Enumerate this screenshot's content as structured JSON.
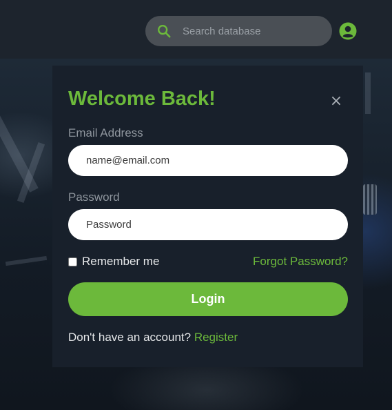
{
  "search": {
    "placeholder": "Search database",
    "icon": "search-icon"
  },
  "account": {
    "icon": "user-circle-icon"
  },
  "login_modal": {
    "title": "Welcome Back!",
    "close_symbol": "×",
    "email": {
      "label": "Email Address",
      "placeholder": "name@email.com"
    },
    "password": {
      "label": "Password",
      "placeholder": "Password"
    },
    "remember_label": "Remember me",
    "remember_checked": false,
    "forgot_label": "Forgot Password?",
    "login_label": "Login",
    "register_prompt": "Don't have an account?",
    "register_link": "Register"
  },
  "colors": {
    "accent": "#6cb93b",
    "topbar": "#1d242d",
    "card": "#18202b",
    "search_bg": "#4a4f55"
  }
}
